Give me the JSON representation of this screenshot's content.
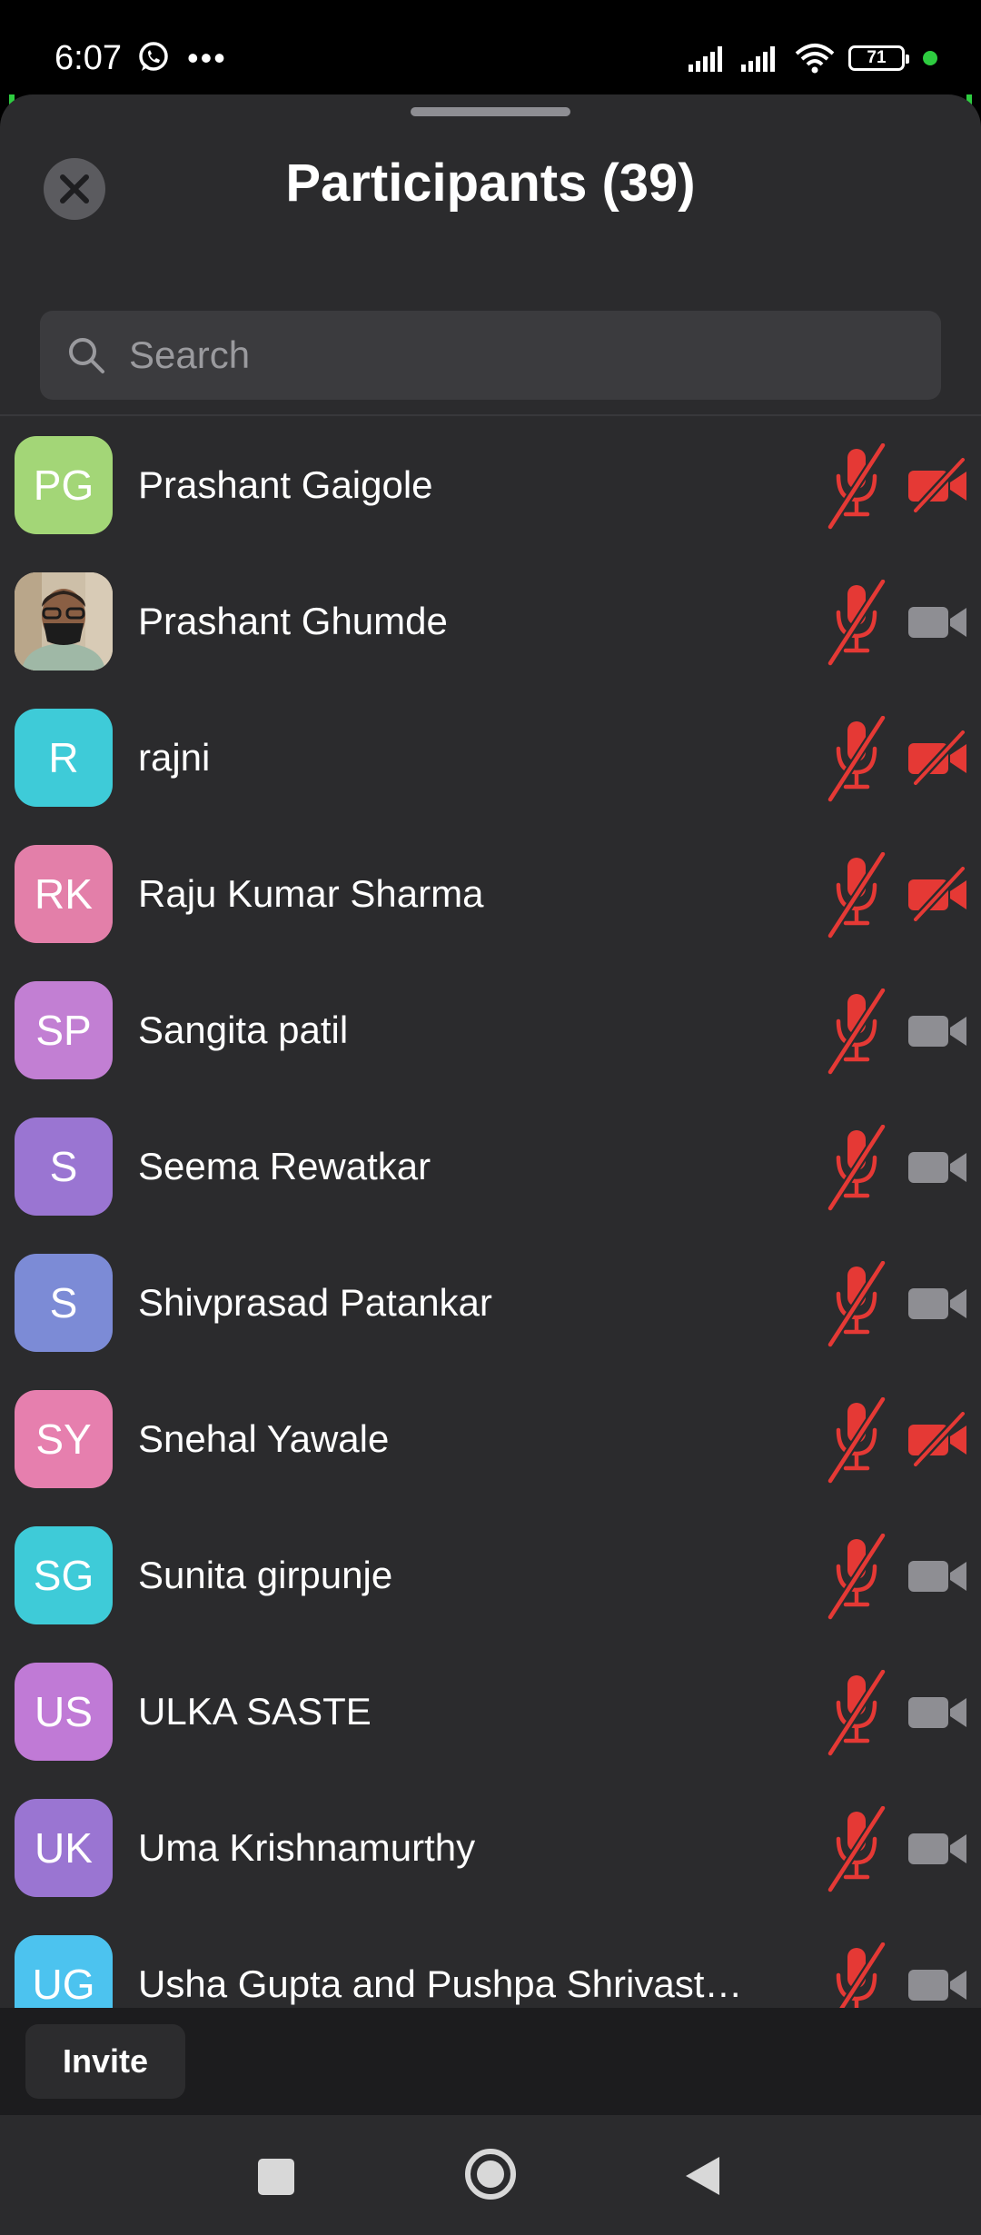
{
  "status_bar": {
    "time": "6:07",
    "dots": "•••",
    "battery": "71",
    "icons": [
      "whatsapp-icon",
      "signal-icon",
      "signal-icon",
      "wifi-icon",
      "battery-icon"
    ]
  },
  "header": {
    "title": "Participants (39)",
    "close_icon": "close-icon"
  },
  "search": {
    "placeholder": "Search",
    "value": ""
  },
  "colors": {
    "muted_red": "#e53935",
    "camera_on_gray": "#8e8e93",
    "sheet_bg": "#2b2b2d"
  },
  "participants": [
    {
      "initials": "PG",
      "name": "Prashant Gaigole",
      "avatar_color": "#a3d677",
      "mic": "muted",
      "camera": "off"
    },
    {
      "initials": "",
      "name": "Prashant Ghumde",
      "avatar_color": "#c9b59a",
      "avatar_type": "photo",
      "mic": "muted",
      "camera": "on"
    },
    {
      "initials": "R",
      "name": "rajni",
      "avatar_color": "#3ecbd8",
      "mic": "muted",
      "camera": "off"
    },
    {
      "initials": "RK",
      "name": "Raju Kumar Sharma",
      "avatar_color": "#e37fa9",
      "mic": "muted",
      "camera": "off"
    },
    {
      "initials": "SP",
      "name": "Sangita patil",
      "avatar_color": "#c27fd3",
      "mic": "muted",
      "camera": "on"
    },
    {
      "initials": "S",
      "name": "Seema  Rewatkar",
      "avatar_color": "#9a75d2",
      "mic": "muted",
      "camera": "on"
    },
    {
      "initials": "S",
      "name": "Shivprasad  Patankar",
      "avatar_color": "#7c8bd6",
      "mic": "muted",
      "camera": "on"
    },
    {
      "initials": "SY",
      "name": "Snehal Yawale",
      "avatar_color": "#e67fae",
      "mic": "muted",
      "camera": "off"
    },
    {
      "initials": "SG",
      "name": "Sunita girpunje",
      "avatar_color": "#3ecbd8",
      "mic": "muted",
      "camera": "on"
    },
    {
      "initials": "US",
      "name": "ULKA SASTE",
      "avatar_color": "#c07ad6",
      "mic": "muted",
      "camera": "on"
    },
    {
      "initials": "UK",
      "name": "Uma Krishnamurthy",
      "avatar_color": "#9a75d2",
      "mic": "muted",
      "camera": "on"
    },
    {
      "initials": "UG",
      "name": "Usha Gupta and Pushpa Shrivast…",
      "avatar_color": "#4cc3ef",
      "mic": "muted",
      "camera": "on"
    }
  ],
  "footer": {
    "invite_label": "Invite"
  },
  "nav_bar": {
    "icons": [
      "recents-icon",
      "home-icon",
      "back-icon"
    ]
  }
}
